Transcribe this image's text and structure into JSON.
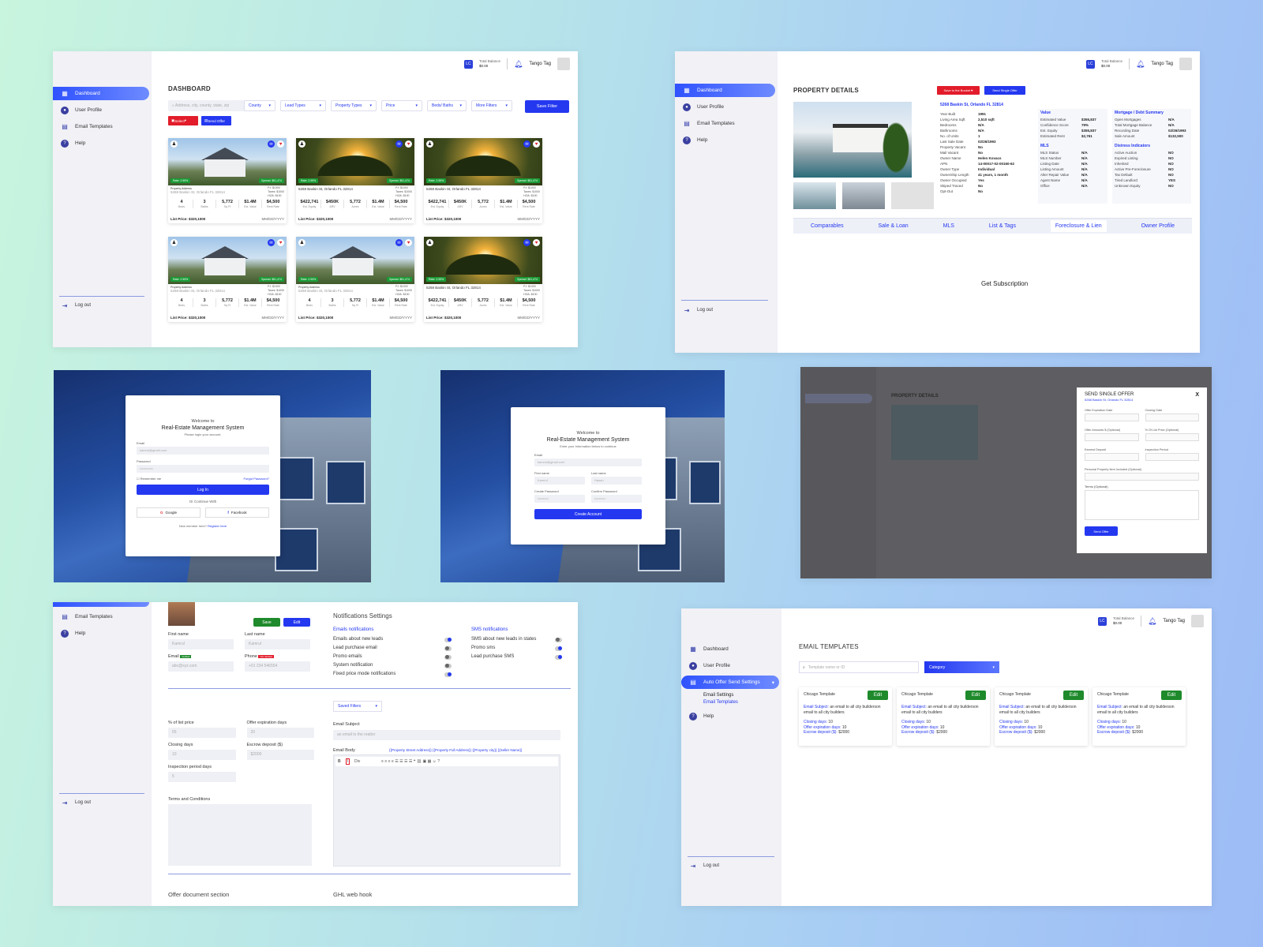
{
  "common": {
    "balance_label": "Total Balance",
    "balance_value": "$0.00",
    "user_name": "Tango Tag",
    "nav": {
      "dashboard": "Dashboard",
      "profile": "User Profile",
      "email_templates": "Email Templates",
      "help": "Help",
      "logout": "Log out"
    }
  },
  "dashboard": {
    "title": "DASHBOARD",
    "search_placeholder": "Address, city, county, state, zip",
    "filters": [
      "County",
      "Lead Types",
      "Property Types",
      "Price",
      "Beds/ Baths",
      "More Filters"
    ],
    "save_filter": "Save Filter",
    "select": "Select",
    "send_offer": "Send Offer",
    "cards": [
      {
        "img": "house",
        "address": "5268 Baskin St, Orlando FL 32814",
        "addr_label": "Property Address",
        "side": [
          "P.I: $1000",
          "Taxes: $1000",
          "HOA: $100"
        ],
        "stats": [
          [
            "4",
            "Beds"
          ],
          [
            "3",
            "Baths"
          ],
          [
            "5,772",
            "Sq Ft"
          ],
          [
            "$1.4M",
            "Est. Value"
          ],
          [
            "$4,500",
            "Rent Rate"
          ]
        ],
        "list_price": "List Price: $320,1000",
        "date": "MM/DD/YYYY",
        "badge_l": "Rate: 2.95%",
        "badge_r": "Spread: $51,474"
      },
      {
        "img": "sunset",
        "address": "5268 Baskin St, Orlando FL 32814",
        "addr_label": "",
        "side": [
          "P.I: $1000",
          "Taxes: $1000",
          "HOA: $100"
        ],
        "stats": [
          [
            "$422,741",
            "Est. Equity"
          ],
          [
            "$450K",
            "ARV"
          ],
          [
            "5,772",
            "Acres"
          ],
          [
            "$1.4M",
            "Est. Value"
          ],
          [
            "$4,500",
            "Rent Rate"
          ]
        ],
        "list_price": "List Price: $320,1000",
        "date": "MM/DD/YYYY",
        "badge_l": "Rate: 2.95%",
        "badge_r": "Spread: $51,474"
      },
      {
        "img": "sunset",
        "address": "5268 Baskin St, Orlando FL 32814",
        "addr_label": "",
        "side": [
          "P.I: $1000",
          "Taxes: $1000",
          "HOA: $100"
        ],
        "stats": [
          [
            "$422,741",
            "Est. Equity"
          ],
          [
            "$450K",
            "ARV"
          ],
          [
            "5,772",
            "Acres"
          ],
          [
            "$1.4M",
            "Est. Value"
          ],
          [
            "$4,500",
            "Rent Rate"
          ]
        ],
        "list_price": "List Price: $320,1000",
        "date": "MM/DD/YYYY",
        "badge_l": "Rate: 2.95%",
        "badge_r": "Spread: $51,474"
      },
      {
        "img": "house",
        "address": "5268 Baskin St, Orlando FL 32814",
        "addr_label": "Property Address",
        "side": [
          "P.I: $1000",
          "Taxes: $1000",
          "HOA: $100"
        ],
        "stats": [
          [
            "4",
            "Beds"
          ],
          [
            "3",
            "Baths"
          ],
          [
            "5,772",
            "Sq Ft"
          ],
          [
            "$1.4M",
            "Est. Value"
          ],
          [
            "$4,500",
            "Rent Rate"
          ]
        ],
        "list_price": "List Price: $320,1000",
        "date": "MM/DD/YYYY",
        "badge_l": "Rate: 2.95%",
        "badge_r": "Spread: $51,474"
      },
      {
        "img": "house",
        "address": "5268 Baskin St, Orlando FL 32814",
        "addr_label": "Property Address",
        "side": [
          "P.I: $1000",
          "Taxes: $1000",
          "HOA: $100"
        ],
        "stats": [
          [
            "4",
            "Beds"
          ],
          [
            "3",
            "Baths"
          ],
          [
            "5,772",
            "Sq Ft"
          ],
          [
            "$1.4M",
            "Est. Value"
          ],
          [
            "$4,500",
            "Rent Rate"
          ]
        ],
        "list_price": "List Price: $320,1000",
        "date": "MM/DD/YYYY",
        "badge_l": "Rate: 2.95%",
        "badge_r": "Spread: $51,474"
      },
      {
        "img": "sunset",
        "address": "5268 Baskin St, Orlando FL 32814",
        "addr_label": "",
        "side": [
          "P.I: $1000",
          "Taxes: $1000",
          "HOA: $100"
        ],
        "stats": [
          [
            "$422,741",
            "Est. Equity"
          ],
          [
            "$450K",
            "ARV"
          ],
          [
            "5,772",
            "Acres"
          ],
          [
            "$1.4M",
            "Est. Value"
          ],
          [
            "$4,500",
            "Rent Rate"
          ]
        ],
        "list_price": "List Price: $320,1000",
        "date": "MM/DD/YYYY",
        "badge_l": "Rate: 2.95%",
        "badge_r": "Spread: $51,474"
      }
    ]
  },
  "details": {
    "title": "PROPERTY DETAILS",
    "save_bucket": "Save to the Bucket",
    "send_single": "Send Single Offer",
    "address": "5268 Baskin St, Orlando FL 32814",
    "facts": [
      [
        "Year Built",
        "1991"
      ],
      [
        "Living Area Sqft",
        "2,510 sqft"
      ],
      [
        "Bedrooms",
        "N/A"
      ],
      [
        "Bathrooms",
        "N/A"
      ],
      [
        "No. of Units",
        "1"
      ],
      [
        "Last Sale Date",
        "02/26/1993"
      ],
      [
        "Property Vacant",
        "No"
      ],
      [
        "Mail Vacant",
        "No"
      ],
      [
        "Owner Name",
        "Helen Kovacs"
      ],
      [
        "APN",
        "14-00017-02-00160-62"
      ],
      [
        "Owner Type",
        "Individual"
      ],
      [
        "Ownership Length",
        "41 years, 1 month"
      ],
      [
        "Owner Occupied",
        "Yes"
      ],
      [
        "Skiped Traced",
        "No"
      ],
      [
        "Opt-Out",
        "No"
      ]
    ],
    "value_title": "Value",
    "value": [
      [
        "Estimated Value",
        "$355,837"
      ],
      [
        "Confidence Score",
        "79%"
      ],
      [
        "Est. Equity",
        "$355,837"
      ],
      [
        "Estimated Rent",
        "$2,761"
      ]
    ],
    "mls_title": "MLS",
    "mls": [
      [
        "MLS Status",
        "N/A"
      ],
      [
        "MLS Number",
        "N/A"
      ],
      [
        "Listing Date",
        "N/A"
      ],
      [
        "Listing Amount",
        "N/A"
      ],
      [
        "Alter Repair Value",
        "N/A"
      ],
      [
        "Agent Name",
        "N/A"
      ],
      [
        "Office",
        "N/A"
      ]
    ],
    "mortgage_title": "Mortgage / Debt Summary",
    "mortgage": [
      [
        "Open Mortgages",
        "N/A"
      ],
      [
        "Total Mortgage Balance",
        "N/A"
      ],
      [
        "Recording Date",
        "02/26/1993"
      ],
      [
        "Sale Amount",
        "$132,500"
      ]
    ],
    "distress_title": "Distress Indicators",
    "distress": [
      [
        "Active Auction",
        "NO"
      ],
      [
        "Expired Listing",
        "NO"
      ],
      [
        "Inherited",
        "NO"
      ],
      [
        "Active Pre-Foreclosure",
        "NO"
      ],
      [
        "Tax Default",
        "NO"
      ],
      [
        "Tired Landlord",
        "YES"
      ],
      [
        "Unknown Equity",
        "NO"
      ]
    ],
    "tabs": [
      "Comparables",
      "Sale & Loan",
      "MLS",
      "List & Tags",
      "Foreclosure & Lien",
      "Owner Profile"
    ],
    "subscription": "Get Subscription"
  },
  "login": {
    "welcome": "Welcome to",
    "system": "Real-Estate Management System",
    "sub": "Please login your account.",
    "email_label": "Email",
    "email_ph": "kamrul@gmail.com",
    "password_label": "Password",
    "password_ph": "••••••••••••",
    "remember": "Remember me",
    "forgot": "Forgot Password?",
    "login_btn": "Log In",
    "continue": "Or Continue With",
    "google": "Google",
    "facebook": "Facebook",
    "new_member": "New member here?",
    "register": "Register here"
  },
  "signup": {
    "welcome": "Welcome to",
    "system": "Real-Estate Management System",
    "sub": "Enter your information below to continue",
    "email_label": "Email",
    "email_ph": "kamrul@gmail.com",
    "first_label": "First name",
    "first_ph": "Kamrul",
    "last_label": "Last name",
    "last_ph": "Hasan",
    "create_pw_label": "Create Password",
    "confirm_pw_label": "Confirm Password",
    "pw_ph": "••••••••••",
    "create_btn": "Create Account"
  },
  "modal": {
    "title": "SEND SINGLE OFFER",
    "address": "5268 Baskin St, Orlando FL 32814",
    "close": "X",
    "fields": [
      "Offer Expiration Date",
      "Closing Date",
      "Offer Amounts $ (Optional)",
      "% Of List Price (Optional)",
      "Earnest Deposit",
      "Inspection Period",
      "Personal Property Item Included (Optional)"
    ],
    "terms": "Terms (Optional)",
    "send": "Send Offer",
    "bg_title": "PROPERTY DETAILS"
  },
  "settings": {
    "save": "Save",
    "edit": "Edit",
    "first_name_label": "First name",
    "first_name_val": "Kamrul",
    "last_name_label": "Last name",
    "last_name_val": "Kamrul",
    "email_label": "Email",
    "email_badge": "Verified",
    "email_val": "abc@xyz.com",
    "phone_label": "Phone",
    "phone_badge": "Not Verified",
    "phone_val": "+01 234 546554",
    "notif_title": "Notifications Settings",
    "email_notif_title": "Emails notifications",
    "email_notifs": [
      [
        "Emails about new leads",
        true
      ],
      [
        "Lead purchase email",
        false
      ],
      [
        "Promo emails",
        false
      ],
      [
        "System notification",
        false
      ],
      [
        "Fixed price mode notifications",
        true
      ]
    ],
    "sms_title": "SMS notifications",
    "sms_notifs": [
      [
        "SMS about new leads in states",
        false
      ],
      [
        "Promo sms",
        true
      ],
      [
        "Lead purchase SMS",
        true
      ]
    ],
    "saved_filters": "Saved Filters",
    "offer_fields": [
      [
        "% of list price",
        "65"
      ],
      [
        "Offer expiration days",
        "20"
      ],
      [
        "Closing days",
        "10"
      ],
      [
        "Escrow deposit ($)",
        "$2000"
      ],
      [
        "Inspection period days",
        "5"
      ]
    ],
    "terms_label": "Terms and Conditions",
    "email_subject_label": "Email Subject",
    "email_subject_ph": "an email to the realtor",
    "email_body_label": "Email Body",
    "placeholders": "{{Property Street Address}} {{Property Full Address}} {{Property city}} {{Seller Name}}",
    "editor_block": "Div",
    "offer_doc": "Offer document section",
    "ghl": "GHL web hook",
    "nav_email_templates": "Email Templates",
    "nav_help": "Help",
    "nav_logout": "Log out"
  },
  "templates": {
    "title": "EMAIL TEMPLATES",
    "search_ph": "Template name or ID",
    "category": "Category",
    "nav": {
      "dashboard": "Dashboard",
      "profile": "User Profile",
      "auto": "Auto Offer Send Settings",
      "email_settings": "Email Settings",
      "email_templates": "Email Templates",
      "help": "Help",
      "logout": "Log out"
    },
    "cards": [
      {
        "name": "Chicago Template",
        "edit": "Edit",
        "subject_label": "Email Subject:",
        "subject": "an email to all city builderson email to all city builders",
        "closing_label": "Closing days:",
        "closing": "10",
        "exp_label": "Offer expiration days:",
        "exp": "10",
        "escrow_label": "Escrow deposit ($):",
        "escrow": "$2000"
      },
      {
        "name": "Chicago Template",
        "edit": "Edit",
        "subject_label": "Email Subject:",
        "subject": "an email to all city builderson email to all city builders",
        "closing_label": "Closing days:",
        "closing": "10",
        "exp_label": "Offer expiration days:",
        "exp": "10",
        "escrow_label": "Escrow deposit ($):",
        "escrow": "$2000"
      },
      {
        "name": "Chicago Template",
        "edit": "Edit",
        "subject_label": "Email Subject:",
        "subject": "an email to all city builderson email to all city builders",
        "closing_label": "Closing days:",
        "closing": "10",
        "exp_label": "Offer expiration days:",
        "exp": "10",
        "escrow_label": "Escrow deposit ($):",
        "escrow": "$2000"
      },
      {
        "name": "Chicago Template",
        "edit": "Edit",
        "subject_label": "Email Subject:",
        "subject": "an email to all city builderson email to all city builders",
        "closing_label": "Closing days:",
        "closing": "10",
        "exp_label": "Offer expiration days:",
        "exp": "10",
        "escrow_label": "Escrow deposit ($):",
        "escrow": "$2000"
      }
    ]
  }
}
